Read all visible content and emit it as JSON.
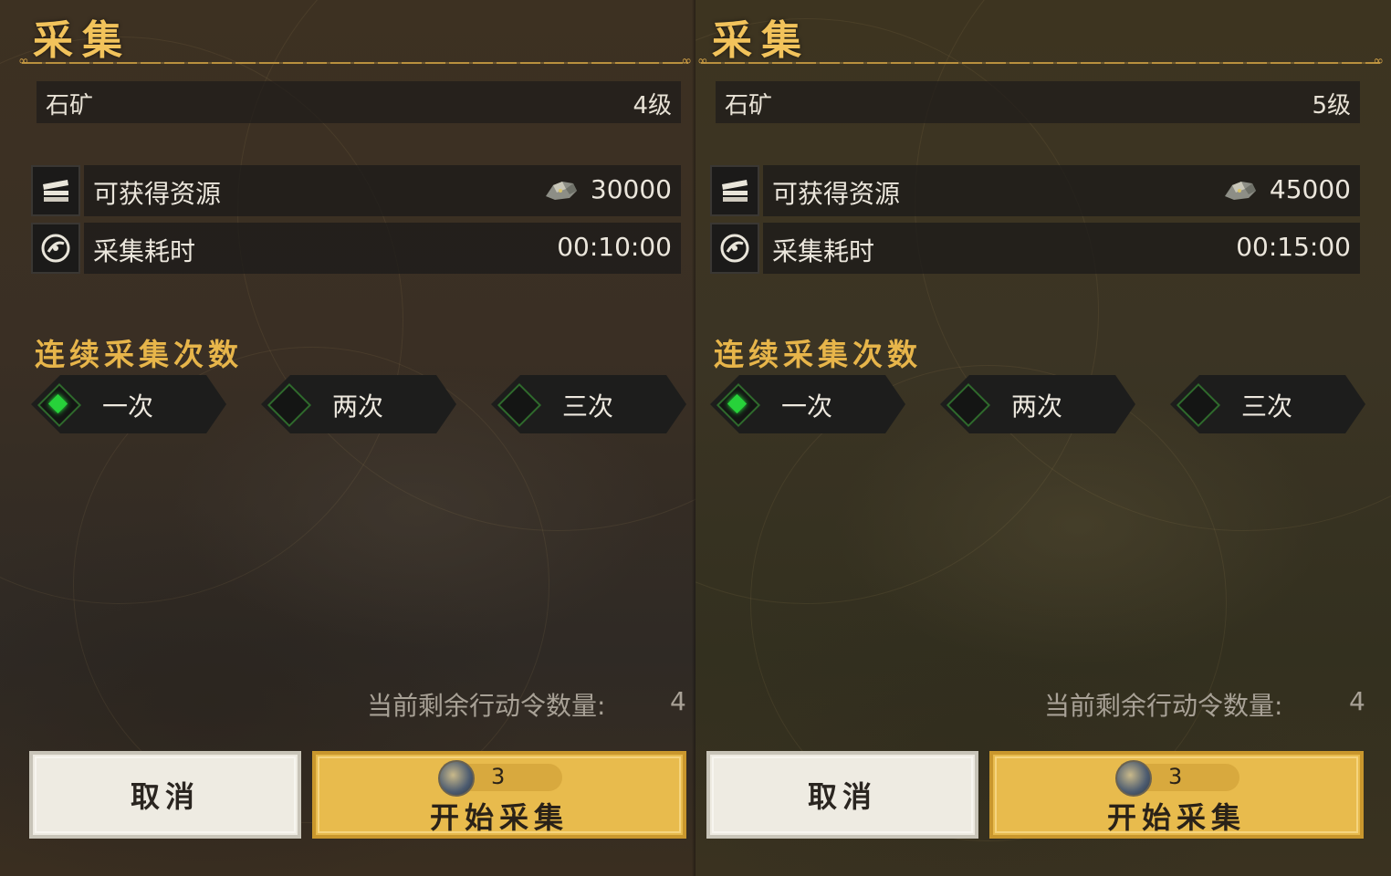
{
  "panels": [
    {
      "title": "采集",
      "resource_name": "石矿",
      "level": "4级",
      "rows": {
        "resource": {
          "label": "可获得资源",
          "value": "30000",
          "icon": "crate-icon"
        },
        "time": {
          "label": "采集耗时",
          "value": "00:10:00",
          "icon": "clock-icon"
        }
      },
      "repeat_heading": "连续采集次数",
      "options": [
        {
          "label": "一次",
          "selected": true
        },
        {
          "label": "两次",
          "selected": false
        },
        {
          "label": "三次",
          "selected": false
        }
      ],
      "remaining_label": "当前剩余行动令数量:",
      "remaining_value": "4",
      "cancel_label": "取消",
      "start_cost": "3",
      "start_label": "开始采集"
    },
    {
      "title": "采集",
      "resource_name": "石矿",
      "level": "5级",
      "rows": {
        "resource": {
          "label": "可获得资源",
          "value": "45000",
          "icon": "crate-icon"
        },
        "time": {
          "label": "采集耗时",
          "value": "00:15:00",
          "icon": "clock-icon"
        }
      },
      "repeat_heading": "连续采集次数",
      "options": [
        {
          "label": "一次",
          "selected": true
        },
        {
          "label": "两次",
          "selected": false
        },
        {
          "label": "三次",
          "selected": false
        }
      ],
      "remaining_label": "当前剩余行动令数量:",
      "remaining_value": "4",
      "cancel_label": "取消",
      "start_cost": "3",
      "start_label": "开始采集"
    }
  ],
  "colors": {
    "gold_title": "#f2c35b",
    "gold_button": "#e8bb4d",
    "selected_green": "#27d23a"
  }
}
